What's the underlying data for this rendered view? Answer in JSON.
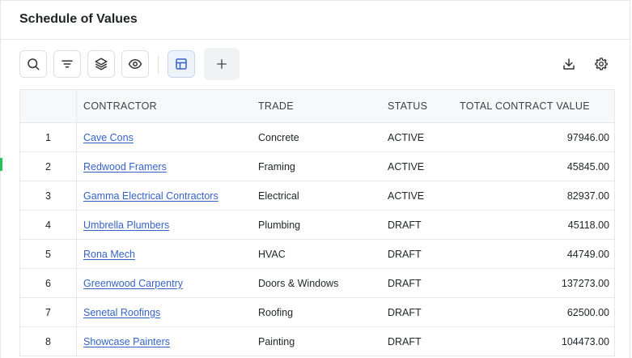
{
  "page": {
    "title": "Schedule of Values"
  },
  "toolbar": {
    "buttons": [
      {
        "name": "search",
        "icon": "search-icon"
      },
      {
        "name": "filter",
        "icon": "filter-icon"
      },
      {
        "name": "layers",
        "icon": "layers-icon"
      },
      {
        "name": "view",
        "icon": "eye-icon"
      },
      {
        "name": "table-view",
        "icon": "table-icon",
        "active": true
      },
      {
        "name": "add",
        "icon": "plus-icon"
      }
    ],
    "right_icons": [
      "download-icon",
      "gear-icon"
    ]
  },
  "table": {
    "columns": [
      "",
      "CONTRACTOR",
      "TRADE",
      "STATUS",
      "TOTAL CONTRACT VALUE"
    ],
    "rows": [
      {
        "num": "1",
        "contractor": "Cave Cons",
        "trade": "Concrete",
        "status": "ACTIVE",
        "value": "97946.00"
      },
      {
        "num": "2",
        "contractor": "Redwood Framers",
        "trade": "Framing",
        "status": "ACTIVE",
        "value": "45845.00"
      },
      {
        "num": "3",
        "contractor": "Gamma Electrical Contractors",
        "trade": "Electrical",
        "status": "ACTIVE",
        "value": "82937.00"
      },
      {
        "num": "4",
        "contractor": "Umbrella Plumbers",
        "trade": "Plumbing",
        "status": "DRAFT",
        "value": "45118.00"
      },
      {
        "num": "5",
        "contractor": "Rona Mech",
        "trade": "HVAC",
        "status": "DRAFT",
        "value": "44749.00"
      },
      {
        "num": "6",
        "contractor": "Greenwood Carpentry",
        "trade": "Doors & Windows",
        "status": "DRAFT",
        "value": "137273.00"
      },
      {
        "num": "7",
        "contractor": "Senetal Roofings",
        "trade": "Roofing",
        "status": "DRAFT",
        "value": "62500.00"
      },
      {
        "num": "8",
        "contractor": "Showcase Painters",
        "trade": "Painting",
        "status": "DRAFT",
        "value": "104473.00"
      }
    ]
  },
  "colors": {
    "link": "#3463c8",
    "accent": "#26c15a",
    "border": "#e6e8ea"
  }
}
